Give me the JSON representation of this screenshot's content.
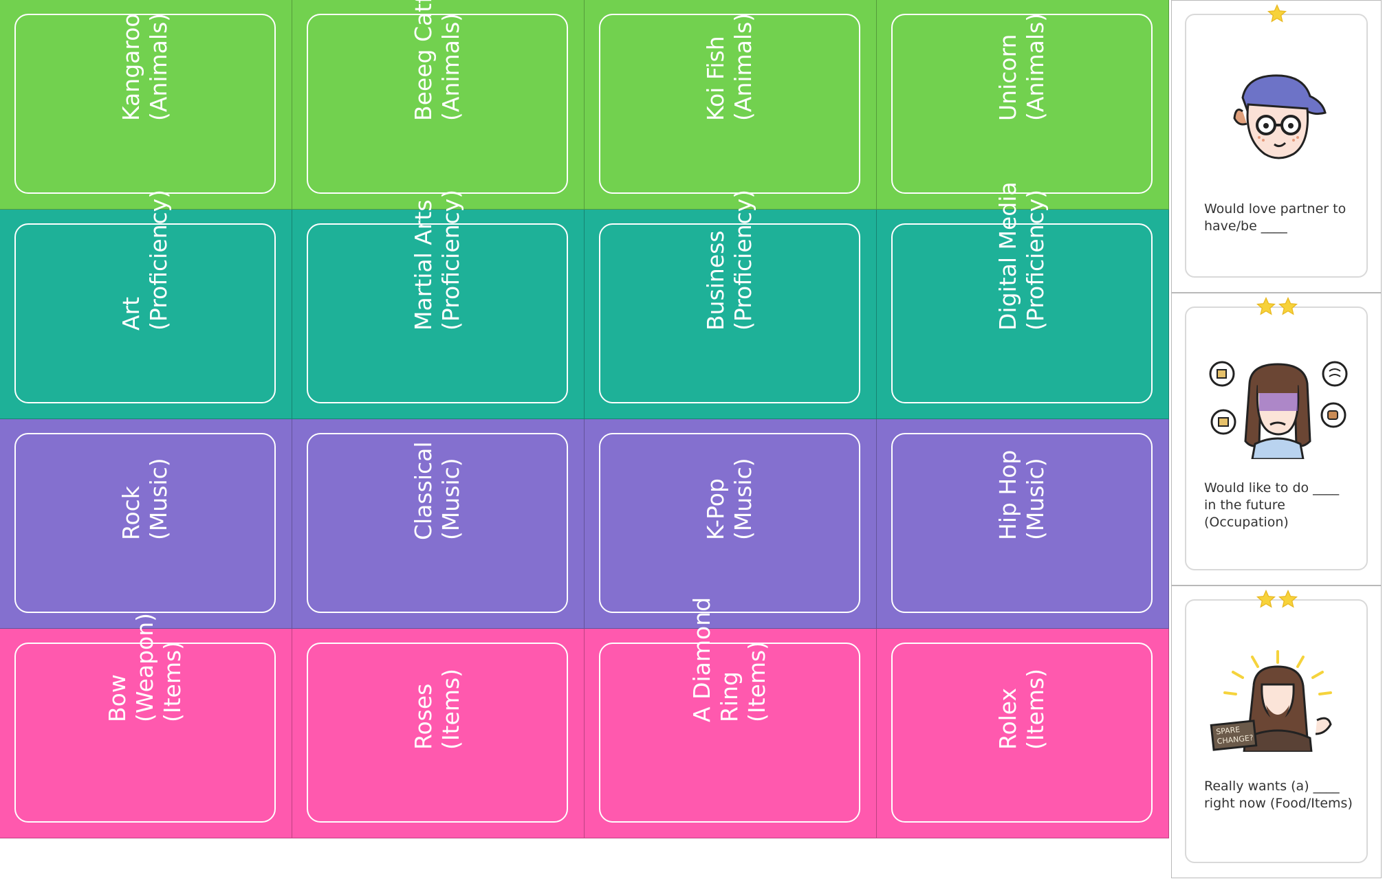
{
  "colors": {
    "animals": "#72d14f",
    "proficiency": "#1eb198",
    "music": "#8470cf",
    "items": "#ff59ae",
    "star": "#f7d23a"
  },
  "rows": [
    {
      "color": "#72d14f",
      "cards": [
        {
          "text": "Kangaroo\n(Animals)"
        },
        {
          "text": "Beeeg Catfish\n(Animals)"
        },
        {
          "text": "Koi Fish\n(Animals)"
        },
        {
          "text": "Unicorn\n(Animals)"
        }
      ]
    },
    {
      "color": "#1eb198",
      "cards": [
        {
          "text": "Art\n(Proficiency)"
        },
        {
          "text": "Martial Arts\n(Proficiency)"
        },
        {
          "text": "Business\n(Proficiency)"
        },
        {
          "text": "Digital Media\n(Proficiency)"
        }
      ]
    },
    {
      "color": "#8470cf",
      "cards": [
        {
          "text": "Rock\n(Music)"
        },
        {
          "text": "Classical\n(Music)"
        },
        {
          "text": "K-Pop\n(Music)"
        },
        {
          "text": "Hip Hop\n(Music)"
        }
      ]
    },
    {
      "color": "#ff59ae",
      "cards": [
        {
          "text": "Bow\n(Weapon)\n(Items)"
        },
        {
          "text": "Roses\n(Items)"
        },
        {
          "text": "A Diamond\nRing\n(Items)"
        },
        {
          "text": "Rolex\n(Items)"
        }
      ]
    }
  ],
  "side_cards": [
    {
      "stars": 1,
      "portrait": "cap-glasses-character-icon",
      "text": "Would love partner to\nhave/be ____"
    },
    {
      "stars": 2,
      "portrait": "thinking-girl-character-icon",
      "text": "Would like to do ____\nin the future\n(Occupation)"
    },
    {
      "stars": 2,
      "portrait": "spare-change-man-character-icon",
      "text": "Really wants (a) ____\nright now (Food/Items)"
    }
  ],
  "portrait_sign": "SPARE\nCHANGE?"
}
